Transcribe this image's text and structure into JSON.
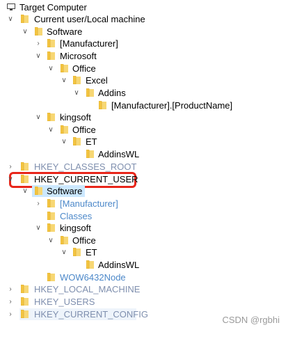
{
  "root_label": "Target Computer",
  "items": [
    {
      "label": "Current user/Local machine"
    },
    {
      "label": "Software"
    },
    {
      "label": "[Manufacturer]"
    },
    {
      "label": "Microsoft"
    },
    {
      "label": "Office"
    },
    {
      "label": "Excel"
    },
    {
      "label": "Addins"
    },
    {
      "label": "[Manufacturer].[ProductName]"
    },
    {
      "label": "kingsoft"
    },
    {
      "label": "Office"
    },
    {
      "label": "ET"
    },
    {
      "label": "AddinsWL"
    },
    {
      "label": "HKEY_CLASSES_ROOT"
    },
    {
      "label": "HKEY_CURRENT_USER"
    },
    {
      "label": "Software"
    },
    {
      "label": "[Manufacturer]"
    },
    {
      "label": "Classes"
    },
    {
      "label": "kingsoft"
    },
    {
      "label": "Office"
    },
    {
      "label": "ET"
    },
    {
      "label": "AddinsWL"
    },
    {
      "label": "WOW6432Node"
    },
    {
      "label": "HKEY_LOCAL_MACHINE"
    },
    {
      "label": "HKEY_USERS"
    },
    {
      "label": "HKEY_CURRENT_CONFIG"
    }
  ],
  "watermark": "CSDN @rgbhi",
  "colors": {
    "folder": "#f4c542",
    "highlight": "#e8261a",
    "selection": "#cce8ff",
    "faded_text": "#7f8fae",
    "link_text": "#4c88c9"
  }
}
